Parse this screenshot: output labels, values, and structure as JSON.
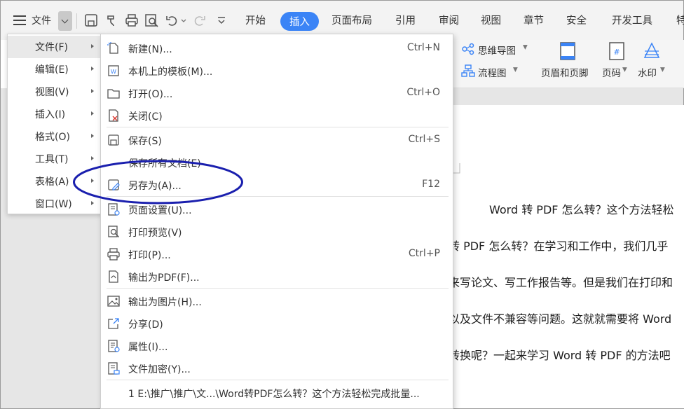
{
  "toolbar": {
    "menu_label": "文件",
    "tabs": [
      "开始",
      "插入",
      "页面布局",
      "引用",
      "审阅",
      "视图",
      "章节",
      "安全",
      "开发工具",
      "特"
    ]
  },
  "ribbon": {
    "mindmap": "思维导图",
    "flowchart": "流程图",
    "header_footer": "页眉和页脚",
    "page_number": "页码",
    "watermark": "水印"
  },
  "left_menu": [
    {
      "label": "文件(F)"
    },
    {
      "label": "编辑(E)"
    },
    {
      "label": "视图(V)"
    },
    {
      "label": "插入(I)"
    },
    {
      "label": "格式(O)"
    },
    {
      "label": "工具(T)"
    },
    {
      "label": "表格(A)"
    },
    {
      "label": "窗口(W)"
    }
  ],
  "file_menu": [
    {
      "label": "新建(N)...",
      "shortcut": "Ctrl+N"
    },
    {
      "label": "本机上的模板(M)...",
      "shortcut": ""
    },
    {
      "label": "打开(O)...",
      "shortcut": "Ctrl+O"
    },
    {
      "label": "关闭(C)",
      "shortcut": ""
    },
    {
      "label": "保存(S)",
      "shortcut": "Ctrl+S"
    },
    {
      "label": "保存所有文档(E)",
      "shortcut": ""
    },
    {
      "label": "另存为(A)...",
      "shortcut": "F12"
    },
    {
      "label": "页面设置(U)...",
      "shortcut": ""
    },
    {
      "label": "打印预览(V)",
      "shortcut": ""
    },
    {
      "label": "打印(P)...",
      "shortcut": "Ctrl+P"
    },
    {
      "label": "输出为PDF(F)...",
      "shortcut": ""
    },
    {
      "label": "输出为图片(H)...",
      "shortcut": ""
    },
    {
      "label": "分享(D)",
      "shortcut": ""
    },
    {
      "label": "属性(I)...",
      "shortcut": ""
    },
    {
      "label": "文件加密(Y)...",
      "shortcut": ""
    },
    {
      "label": "1 E:\\推广\\推广\\文...\\Word转PDF怎么转？这个方法轻松完成批量...",
      "shortcut": ""
    }
  ],
  "document": {
    "lines": [
      "Word 转 PDF 怎么转？这个方法轻松",
      "转 PDF 怎么转？在学习和工作中，我们几乎",
      "来写论文、写工作报告等。但是我们在打印和",
      "以及文件不兼容等问题。这就就需要将 Word",
      "转换呢？一起来学习 Word 转 PDF 的方法吧"
    ]
  },
  "colors": {
    "accent": "#3b84f6",
    "annotation": "#1a1fae"
  },
  "icons": [
    "hamburger-icon",
    "save-icon",
    "format-painter-icon",
    "print-icon",
    "print-preview-icon",
    "undo-icon",
    "redo-icon",
    "more-icon"
  ]
}
